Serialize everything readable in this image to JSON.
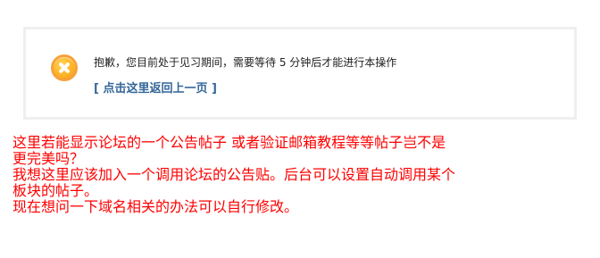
{
  "notice": {
    "message": "抱歉，您目前处于见习期间，需要等待 5 分钟后才能进行本操作",
    "link_text": "[ 点击这里返回上一页 ]",
    "icon": "error-icon",
    "link_color": "#336699",
    "icon_color": "#f6a13b"
  },
  "comment": {
    "color": "#ff0000",
    "lines": [
      "这里若能显示论坛的一个公告帖子 或者验证邮箱教程等等帖子岂不是",
      "更完美吗？",
      "我想这里应该加入一个调用论坛的公告贴。后台可以设置自动调用某个",
      "板块的帖子。",
      "现在想问一下域名相关的办法可以自行修改。"
    ]
  }
}
